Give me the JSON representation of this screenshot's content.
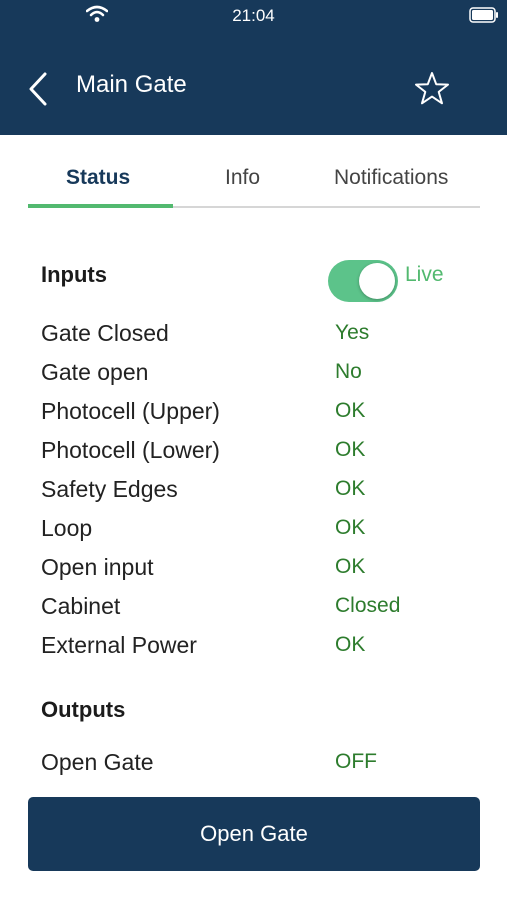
{
  "status_bar": {
    "time": "21:04"
  },
  "header": {
    "title": "Main Gate"
  },
  "tabs": [
    {
      "label": "Status",
      "active": true
    },
    {
      "label": "Info",
      "active": false
    },
    {
      "label": "Notifications",
      "active": false
    }
  ],
  "inputs": {
    "title": "Inputs",
    "live_label": "Live",
    "live_enabled": true,
    "rows": [
      {
        "label": "Gate Closed",
        "value": "Yes"
      },
      {
        "label": "Gate open",
        "value": "No"
      },
      {
        "label": "Photocell (Upper)",
        "value": "OK"
      },
      {
        "label": "Photocell (Lower)",
        "value": "OK"
      },
      {
        "label": "Safety Edges",
        "value": "OK"
      },
      {
        "label": "Loop",
        "value": "OK"
      },
      {
        "label": "Open input",
        "value": "OK"
      },
      {
        "label": "Cabinet",
        "value": "Closed"
      },
      {
        "label": "External Power",
        "value": "OK"
      }
    ]
  },
  "outputs": {
    "title": "Outputs",
    "rows": [
      {
        "label": "Open Gate",
        "value": "OFF"
      }
    ]
  },
  "action": {
    "open_gate_label": "Open Gate"
  },
  "colors": {
    "header": "#17395a",
    "accent_green": "#52b96f",
    "value_green": "#2d7c2d",
    "toggle_on": "#5cc38a"
  }
}
